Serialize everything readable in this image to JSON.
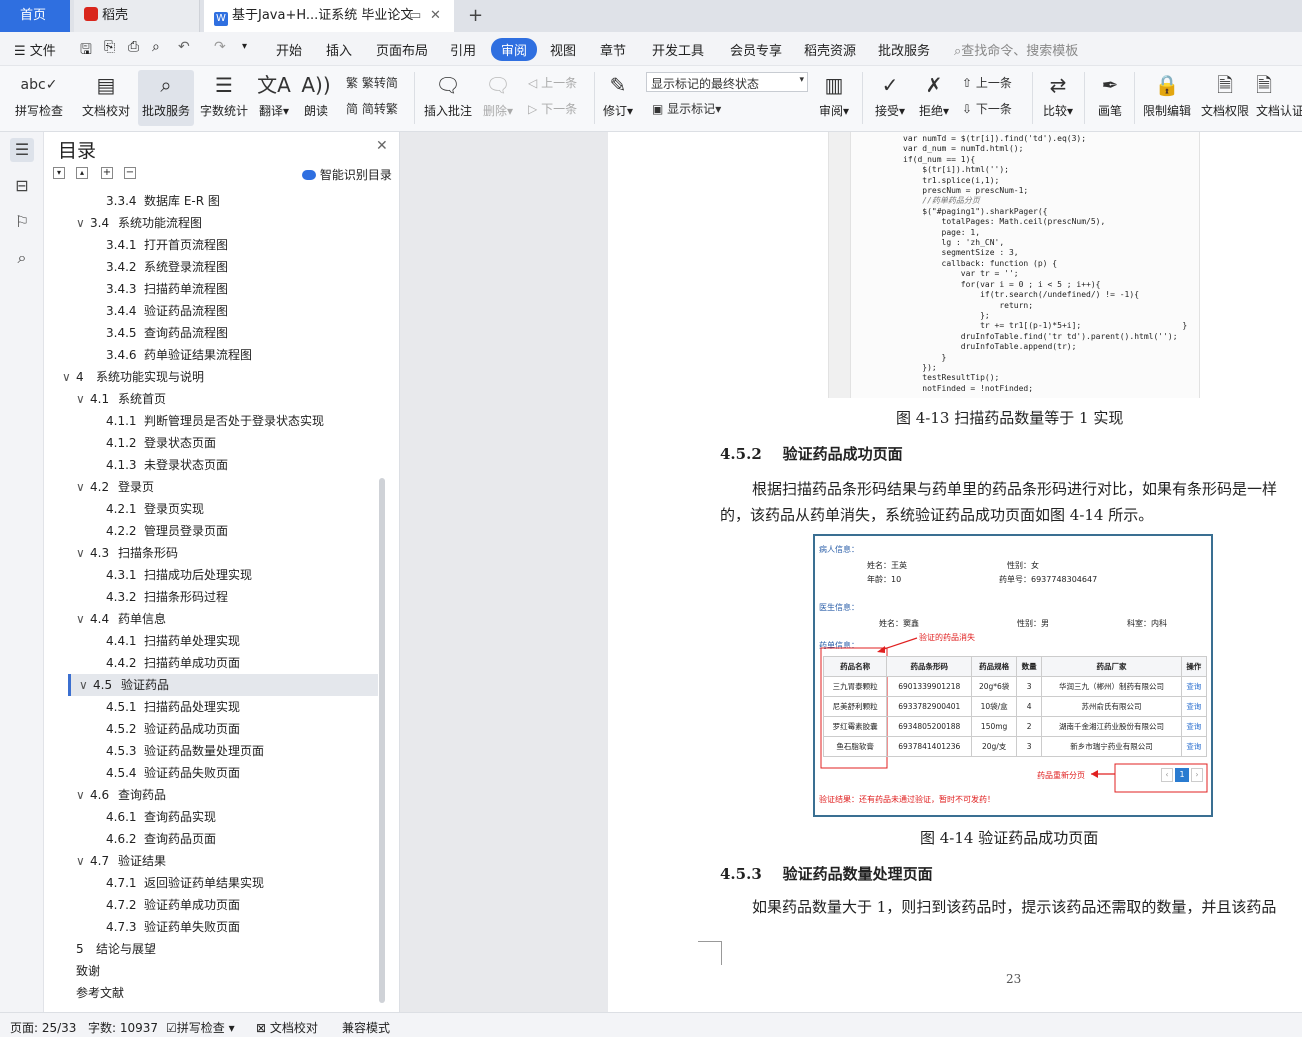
{
  "tabs": [
    {
      "label": "首页"
    },
    {
      "label": "稻壳"
    },
    {
      "label": "基于Java+H...证系统 毕业论文"
    }
  ],
  "new_tab": "+",
  "menu": {
    "file": "文件",
    "items": [
      "开始",
      "插入",
      "页面布局",
      "引用",
      "审阅",
      "视图",
      "章节",
      "开发工具",
      "会员专享",
      "稻壳资源",
      "批改服务"
    ],
    "active": "审阅",
    "search_placeholder": "查找命令、搜索模板"
  },
  "ribbon": {
    "spell": "拼写检查",
    "proof": "文档校对",
    "grading": "批改服务",
    "wordcount": "字数统计",
    "translate": "翻译",
    "read": "朗读",
    "trad": "繁转简",
    "simp": "简转繁",
    "insert_comment": "插入批注",
    "delete": "删除",
    "prev_c": "上一条",
    "next_c": "下一条",
    "track": "修订",
    "markup_select": "显示标记的最终状态",
    "show_markup": "显示标记",
    "review": "审阅",
    "accept": "接受",
    "reject": "拒绝",
    "prev": "上一条",
    "next": "下一条",
    "compare": "比较",
    "ink": "画笔",
    "restrict": "限制编辑",
    "perm": "文档权限",
    "cert": "文档认证"
  },
  "toc": {
    "title": "目录",
    "smart": "智能识别目录",
    "items": [
      {
        "num": "3.3.4",
        "label": "数据库 E-R 图",
        "level": 3
      },
      {
        "num": "3.4",
        "label": "系统功能流程图",
        "level": 2,
        "open": true
      },
      {
        "num": "3.4.1",
        "label": "打开首页流程图",
        "level": 3
      },
      {
        "num": "3.4.2",
        "label": "系统登录流程图",
        "level": 3
      },
      {
        "num": "3.4.3",
        "label": "扫描药单流程图",
        "level": 3
      },
      {
        "num": "3.4.4",
        "label": "验证药品流程图",
        "level": 3
      },
      {
        "num": "3.4.5",
        "label": "查询药品流程图",
        "level": 3
      },
      {
        "num": "3.4.6",
        "label": "药单验证结果流程图",
        "level": 3
      },
      {
        "num": "4",
        "label": "系统功能实现与说明",
        "level": 1,
        "open": true
      },
      {
        "num": "4.1",
        "label": "系统首页",
        "level": 2,
        "open": true
      },
      {
        "num": "4.1.1",
        "label": "判断管理员是否处于登录状态实现",
        "level": 3
      },
      {
        "num": "4.1.2",
        "label": "登录状态页面",
        "level": 3
      },
      {
        "num": "4.1.3",
        "label": "未登录状态页面",
        "level": 3
      },
      {
        "num": "4.2",
        "label": "登录页",
        "level": 2,
        "open": true
      },
      {
        "num": "4.2.1",
        "label": "登录页实现",
        "level": 3
      },
      {
        "num": "4.2.2",
        "label": "管理员登录页面",
        "level": 3
      },
      {
        "num": "4.3",
        "label": "扫描条形码",
        "level": 2,
        "open": true
      },
      {
        "num": "4.3.1",
        "label": "扫描成功后处理实现",
        "level": 3
      },
      {
        "num": "4.3.2",
        "label": "扫描条形码过程",
        "level": 3
      },
      {
        "num": "4.4",
        "label": "药单信息",
        "level": 2,
        "open": true
      },
      {
        "num": "4.4.1",
        "label": "扫描药单处理实现",
        "level": 3
      },
      {
        "num": "4.4.2",
        "label": "扫描药单成功页面",
        "level": 3
      },
      {
        "num": "4.5",
        "label": "验证药品",
        "level": 2,
        "open": true,
        "selected": true
      },
      {
        "num": "4.5.1",
        "label": "扫描药品处理实现",
        "level": 3
      },
      {
        "num": "4.5.2",
        "label": "验证药品成功页面",
        "level": 3
      },
      {
        "num": "4.5.3",
        "label": "验证药品数量处理页面",
        "level": 3
      },
      {
        "num": "4.5.4",
        "label": "验证药品失败页面",
        "level": 3
      },
      {
        "num": "4.6",
        "label": "查询药品",
        "level": 2,
        "open": true
      },
      {
        "num": "4.6.1",
        "label": "查询药品实现",
        "level": 3
      },
      {
        "num": "4.6.2",
        "label": "查询药品页面",
        "level": 3
      },
      {
        "num": "4.7",
        "label": "验证结果",
        "level": 2,
        "open": true
      },
      {
        "num": "4.7.1",
        "label": "返回验证药单结果实现",
        "level": 3
      },
      {
        "num": "4.7.2",
        "label": "验证药单成功页面",
        "level": 3
      },
      {
        "num": "4.7.3",
        "label": "验证药单失败页面",
        "level": 3
      },
      {
        "num": "5",
        "label": "结论与展望",
        "level": 1
      },
      {
        "num": "",
        "label": "致谢",
        "level": 1
      },
      {
        "num": "",
        "label": "参考文献",
        "level": 1
      }
    ]
  },
  "doc": {
    "code_lines": [
      "var numTd = $(tr[i]).find('td').eq(3);",
      "var d_num = numTd.html();",
      "if(d_num == 1){",
      "    $(tr[i]).html('');",
      "    tr1.splice(i,1);",
      "    prescNum = prescNum-1;",
      "    //药单药品分页",
      "    $(\"#paging1\").sharkPager({",
      "        totalPages: Math.ceil(prescNum/5),",
      "        page: 1,",
      "        lg : 'zh_CN',",
      "        segmentSize : 3,",
      "        callback: function (p) {",
      "            var tr = '';",
      "            for(var i = 0 ; i < 5 ; i++){",
      "                if(tr.search(/undefined/) != -1){",
      "                    return;",
      "                };",
      "                tr += tr1[(p-1)*5+i];                     }",
      "            druInfoTable.find('tr td').parent().html('');",
      "            druInfoTable.append(tr);",
      "        }",
      "    });",
      "    testResultTip();",
      "    notFinded = !notFinded;"
    ],
    "fig13_caption": "图 4-13  扫描药品数量等于 1 实现",
    "h452": "4.5.2    验证药品成功页面",
    "p1_line1": "根据扫描药品条形码结果与药单里的药品条形码进行对比，如果有条形码是一样",
    "p1_line2": "的，该药品从药单消失，系统验证药品成功页面如图 4-14 所示。",
    "fig": {
      "patient_label": "病人信息：",
      "name_label": "姓名：王英",
      "sex_label": "性别：女",
      "age_label": "年龄：10",
      "presc_label": "药单号：6937748304647",
      "doctor_label": "医生信息：",
      "dname": "姓名：窦鑫",
      "dsex": "性别：男",
      "ddept": "科室：内科",
      "list_label": "药单信息：",
      "annot1": "验证的药品消失",
      "headers": [
        "药品名称",
        "药品条形码",
        "药品规格",
        "数量",
        "药品厂家",
        "操作"
      ],
      "rows": [
        [
          "三九胃泰颗粒",
          "6901339901218",
          "20g*6袋",
          "3",
          "华润三九（郴州）制药有限公司",
          "查询"
        ],
        [
          "尼美舒利颗粒",
          "6933782900401",
          "10袋/盒",
          "4",
          "苏州俞氏有限公司",
          "查询"
        ],
        [
          "罗红霉素胶囊",
          "6934805200188",
          "150mg",
          "2",
          "湖南千金湘江药业股份有限公司",
          "查询"
        ],
        [
          "鱼石脂软膏",
          "6937841401236",
          "20g/支",
          "3",
          "新乡市瑞宁药业有限公司",
          "查询"
        ]
      ],
      "annot2": "药品重新分页",
      "page_num": "1",
      "result": "验证结果：还有药品未通过验证，暂时不可发药！"
    },
    "fig14_caption": "图 4-14  验证药品成功页面",
    "h453": "4.5.3    验证药品数量处理页面",
    "p2_line1": "如果药品数量大于 1，则扫到该药品时，提示该药品还需取的数量，并且该药品",
    "page_number": "23"
  },
  "status": {
    "page": "页面: 25/33",
    "words": "字数: 10937",
    "spell": "拼写检查",
    "proof": "文档校对",
    "compat": "兼容模式"
  }
}
